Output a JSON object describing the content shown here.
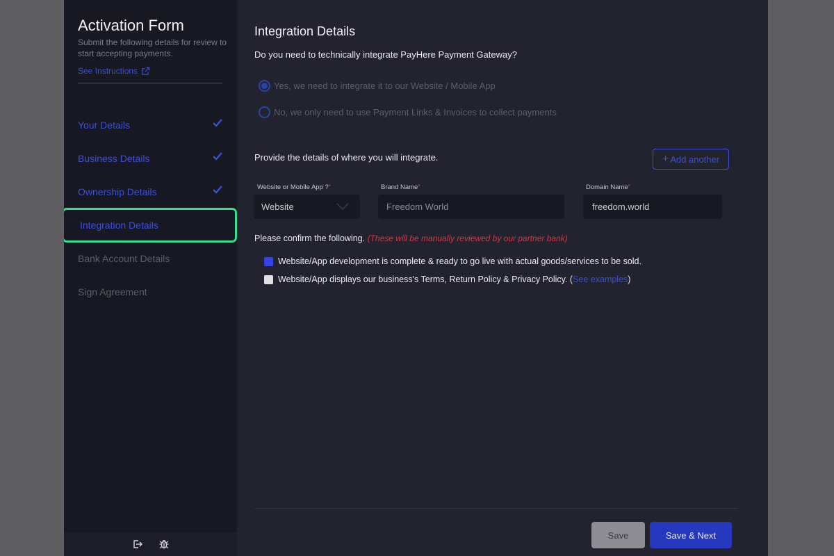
{
  "sidebar": {
    "title": "Activation Form",
    "subtitle": "Submit the following details for review to start accepting payments.",
    "instructions_link": "See Instructions",
    "items": [
      {
        "label": "Your Details",
        "state": "done"
      },
      {
        "label": "Business Details",
        "state": "done"
      },
      {
        "label": "Ownership Details",
        "state": "done"
      },
      {
        "label": "Integration Details",
        "state": "active"
      },
      {
        "label": "Bank Account Details",
        "state": "pending"
      },
      {
        "label": "Sign Agreement",
        "state": "pending"
      }
    ],
    "footer_icons": [
      "logout-icon",
      "bug-icon"
    ]
  },
  "main": {
    "title": "Integration Details",
    "question": "Do you need to technically integrate PayHere Payment Gateway?",
    "radio_options": [
      {
        "label": "Yes, we need to integrate it to our Website / Mobile App",
        "selected": true
      },
      {
        "label": "No, we only need to use Payment Links & Invoices to collect payments",
        "selected": false
      }
    ],
    "provide_text": "Provide the details of where you will integrate.",
    "add_another_label": "Add another",
    "add_another_icon": "+",
    "fields": {
      "type_label": "Website or Mobile App ?",
      "type_value": "Website",
      "brand_label": "Brand Name",
      "brand_value": "Freedom World",
      "domain_label": "Domain Name",
      "domain_value": "freedom.world",
      "required_mark": "*"
    },
    "confirm_text": "Please confirm the following.",
    "confirm_note": "(These will be manually reviewed by our partner bank)",
    "checkboxes": [
      {
        "label": "Website/App development is complete & ready to go live with actual goods/services to be sold.",
        "checked": true
      },
      {
        "label_before": "Website/App displays our business's Terms, Return Policy & Privacy Policy. (",
        "link": "See examples",
        "label_after": ")",
        "checked": false
      }
    ],
    "save_label": "Save",
    "save_next_label": "Save & Next"
  },
  "colors": {
    "accent": "#3b4fd8",
    "highlight": "#34e08e",
    "required": "#d0444a"
  }
}
